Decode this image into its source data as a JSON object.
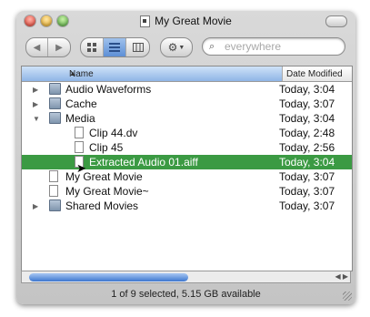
{
  "window": {
    "title": "My Great Movie"
  },
  "toolbar": {
    "back_icon": "back-arrow",
    "forward_icon": "forward-arrow",
    "view_icons": [
      "icon-view",
      "list-view",
      "column-view"
    ],
    "action_icon": "gear-icon"
  },
  "search": {
    "placeholder": "everywhere"
  },
  "columns": {
    "name": "Name",
    "date": "Date Modified"
  },
  "rows": [
    {
      "name": "Audio Waveforms",
      "date": "Today, 3:04",
      "kind": "folder",
      "disclosure": "collapsed",
      "selected": false
    },
    {
      "name": "Cache",
      "date": "Today, 3:07",
      "kind": "folder",
      "disclosure": "collapsed",
      "selected": false
    },
    {
      "name": "Media",
      "date": "Today, 3:04",
      "kind": "folder",
      "disclosure": "expanded",
      "selected": false
    },
    {
      "name": "Clip 44.dv",
      "date": "Today, 2:48",
      "kind": "file",
      "disclosure": "none",
      "selected": false
    },
    {
      "name": "Clip 45",
      "date": "Today, 2:56",
      "kind": "file",
      "disclosure": "none",
      "selected": false
    },
    {
      "name": "Extracted Audio 01.aiff",
      "date": "Today, 3:04",
      "kind": "file",
      "disclosure": "none",
      "selected": true
    },
    {
      "name": "My Great Movie",
      "date": "Today, 3:07",
      "kind": "file",
      "disclosure": "none",
      "selected": false
    },
    {
      "name": "My Great Movie~",
      "date": "Today, 3:07",
      "kind": "file",
      "disclosure": "none",
      "selected": false
    },
    {
      "name": "Shared Movies",
      "date": "Today, 3:07",
      "kind": "folder",
      "disclosure": "collapsed",
      "selected": false
    }
  ],
  "status": {
    "text": "1 of 9 selected, 5.15 GB available"
  },
  "colors": {
    "selection": "#3b9a43",
    "accent": "#5d8fd6"
  }
}
